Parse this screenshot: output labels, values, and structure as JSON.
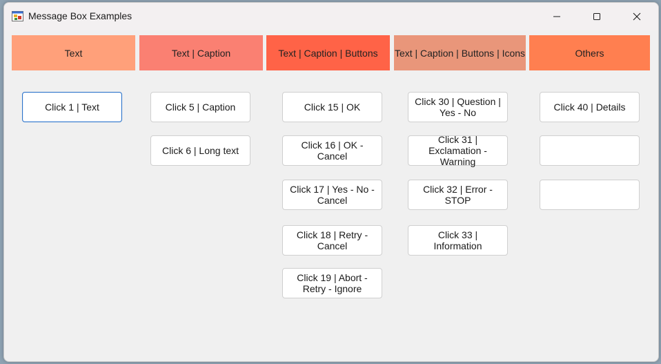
{
  "window": {
    "title": "Message Box Examples"
  },
  "tabs": [
    {
      "label": "Text",
      "color": "#FFA07A"
    },
    {
      "label": "Text | Caption",
      "color": "#FA8072"
    },
    {
      "label": "Text | Caption | Buttons",
      "color": "#FF6347"
    },
    {
      "label": "Text | Caption | Buttons | Icons",
      "color": "#E9967A"
    },
    {
      "label": "Others",
      "color": "#FF7F50"
    }
  ],
  "columns": {
    "text": [
      "Click 1 | Text"
    ],
    "caption": [
      "Click 5 | Caption",
      "Click 6 | Long text"
    ],
    "buttons": [
      "Click 15 | OK",
      "Click 16 | OK - Cancel",
      "Click 17 | Yes - No - Cancel",
      "Click 18 | Retry - Cancel",
      "Click 19 | Abort - Retry - Ignore"
    ],
    "icons": [
      "Click 30 | Question | Yes - No",
      "Click 31 | Exclamation - Warning",
      "Click 32 | Error - STOP",
      "Click 33 | Information"
    ],
    "others": [
      "Click 40 | Details",
      "",
      ""
    ]
  }
}
